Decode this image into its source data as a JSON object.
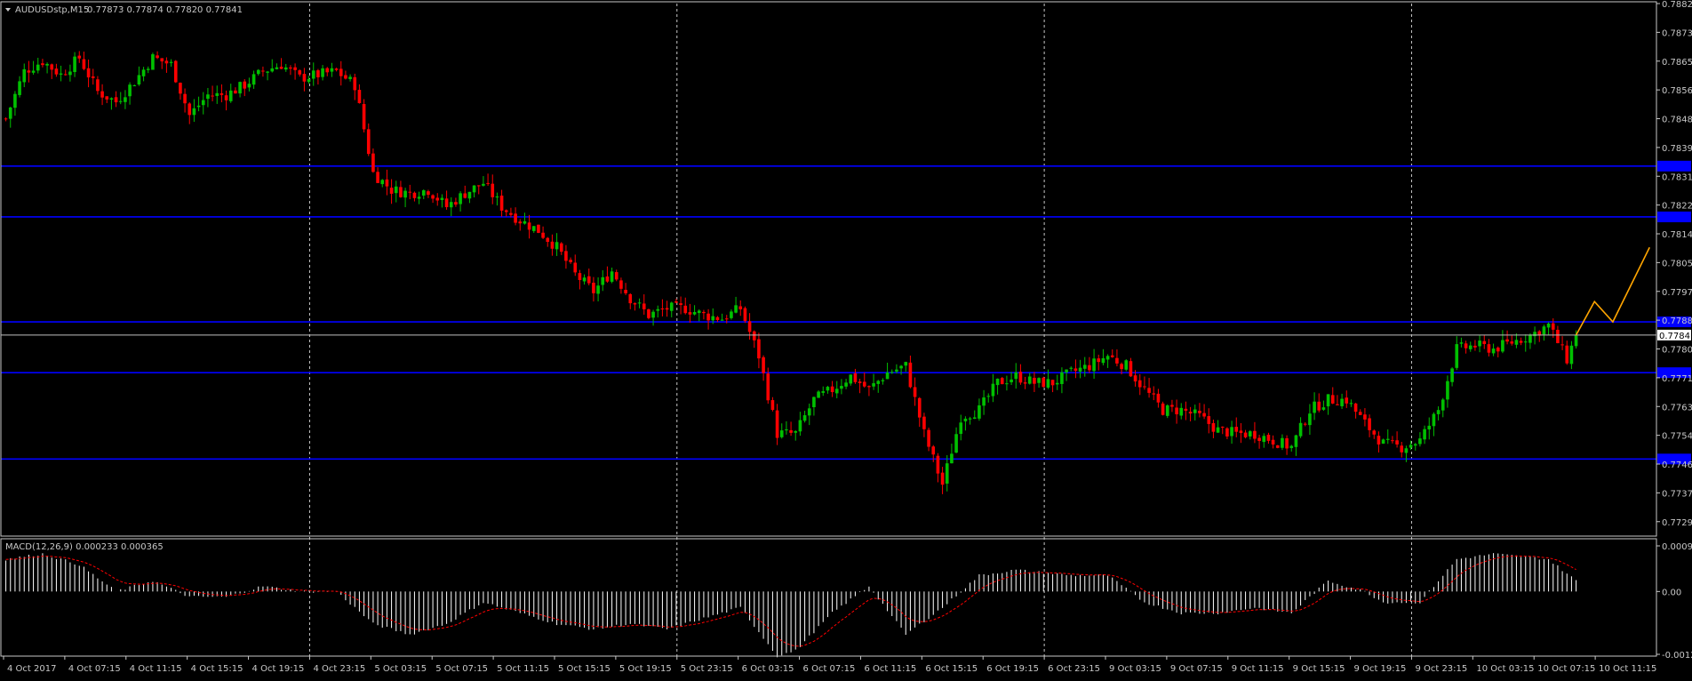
{
  "chart_data": {
    "type": "candlestick",
    "symbol_header": "AUDUSDstp,M15",
    "ohlc_header": "0.77873 0.77874 0.77820 0.77841",
    "last_price": 0.77841,
    "last_price_label": "0.77841",
    "ylim": [
      0.7725,
      0.7882
    ],
    "price_ticks": [
      "0.78820",
      "0.78735",
      "0.78650",
      "0.78565",
      "0.78480",
      "0.78395",
      "0.78310",
      "0.78225",
      "0.78140",
      "0.78055",
      "0.77970",
      "0.77885",
      "0.77800",
      "0.77715",
      "0.77630",
      "0.77545",
      "0.77460",
      "0.77375",
      "0.77290"
    ],
    "horizontal_levels": [
      0.7834,
      0.7819,
      0.7788,
      0.7773,
      0.77475
    ],
    "horizontal_level_color": "#0000ff",
    "time_labels": [
      "4 Oct 2017",
      "4 Oct 07:15",
      "4 Oct 11:15",
      "4 Oct 15:15",
      "4 Oct 19:15",
      "4 Oct 23:15",
      "5 Oct 03:15",
      "5 Oct 07:15",
      "5 Oct 11:15",
      "5 Oct 15:15",
      "5 Oct 19:15",
      "5 Oct 23:15",
      "6 Oct 03:15",
      "6 Oct 07:15",
      "6 Oct 11:15",
      "6 Oct 15:15",
      "6 Oct 19:15",
      "6 Oct 23:15",
      "9 Oct 03:15",
      "9 Oct 07:15",
      "9 Oct 11:15",
      "9 Oct 15:15",
      "9 Oct 19:15",
      "9 Oct 23:15",
      "10 Oct 03:15",
      "10 Oct 07:15",
      "10 Oct 11:15"
    ],
    "day_separator_labels": [
      "4 Oct 23:15",
      "5 Oct 23:15",
      "6 Oct 23:15",
      "9 Oct 23:15"
    ],
    "close_path": [
      [
        0,
        0.7848
      ],
      [
        4,
        0.7862
      ],
      [
        8,
        0.7865
      ],
      [
        12,
        0.7861
      ],
      [
        16,
        0.7866
      ],
      [
        20,
        0.7856
      ],
      [
        24,
        0.7853
      ],
      [
        28,
        0.7859
      ],
      [
        32,
        0.7866
      ],
      [
        36,
        0.7864
      ],
      [
        40,
        0.7849
      ],
      [
        44,
        0.7855
      ],
      [
        48,
        0.7855
      ],
      [
        52,
        0.7858
      ],
      [
        56,
        0.7862
      ],
      [
        60,
        0.7864
      ],
      [
        64,
        0.786
      ],
      [
        68,
        0.7861
      ],
      [
        72,
        0.7862
      ],
      [
        76,
        0.7858
      ],
      [
        80,
        0.7832
      ],
      [
        84,
        0.7827
      ],
      [
        88,
        0.7826
      ],
      [
        92,
        0.7827
      ],
      [
        96,
        0.7822
      ],
      [
        100,
        0.7826
      ],
      [
        104,
        0.7829
      ],
      [
        108,
        0.7822
      ],
      [
        112,
        0.7818
      ],
      [
        116,
        0.7815
      ],
      [
        120,
        0.781
      ],
      [
        124,
        0.7802
      ],
      [
        128,
        0.7797
      ],
      [
        132,
        0.7803
      ],
      [
        136,
        0.7795
      ],
      [
        140,
        0.779
      ],
      [
        144,
        0.7792
      ],
      [
        148,
        0.7792
      ],
      [
        152,
        0.779
      ],
      [
        156,
        0.7789
      ],
      [
        160,
        0.7792
      ],
      [
        164,
        0.7778
      ],
      [
        168,
        0.7755
      ],
      [
        172,
        0.7755
      ],
      [
        176,
        0.7765
      ],
      [
        180,
        0.7768
      ],
      [
        184,
        0.7772
      ],
      [
        188,
        0.7768
      ],
      [
        192,
        0.7773
      ],
      [
        196,
        0.7775
      ],
      [
        200,
        0.7755
      ],
      [
        204,
        0.774
      ],
      [
        208,
        0.776
      ],
      [
        212,
        0.7762
      ],
      [
        216,
        0.777
      ],
      [
        220,
        0.7772
      ],
      [
        224,
        0.777
      ],
      [
        228,
        0.777
      ],
      [
        232,
        0.7773
      ],
      [
        236,
        0.7775
      ],
      [
        240,
        0.7778
      ],
      [
        244,
        0.7775
      ],
      [
        248,
        0.7768
      ],
      [
        252,
        0.7762
      ],
      [
        256,
        0.7762
      ],
      [
        260,
        0.776
      ],
      [
        264,
        0.7756
      ],
      [
        268,
        0.7755
      ],
      [
        272,
        0.7755
      ],
      [
        276,
        0.7753
      ],
      [
        280,
        0.7751
      ],
      [
        284,
        0.7762
      ],
      [
        288,
        0.7765
      ],
      [
        292,
        0.7765
      ],
      [
        296,
        0.7758
      ],
      [
        300,
        0.7752
      ],
      [
        304,
        0.7751
      ],
      [
        308,
        0.7753
      ],
      [
        312,
        0.7762
      ],
      [
        316,
        0.778
      ],
      [
        320,
        0.7781
      ],
      [
        324,
        0.778
      ],
      [
        328,
        0.7782
      ],
      [
        332,
        0.7784
      ],
      [
        336,
        0.7787
      ],
      [
        340,
        0.7777
      ],
      [
        342,
        0.7784
      ]
    ],
    "forecast_path": [
      [
        342,
        0.77841
      ],
      [
        346,
        0.7794
      ],
      [
        350,
        0.7788
      ],
      [
        358,
        0.781
      ]
    ],
    "forecast_color": "#ffa500",
    "up_color": "#00c000",
    "down_color": "#ff0000",
    "macd": {
      "label": "MACD(12,26,9) 0.000233 0.000365",
      "ylim": [
        -0.0012,
        0.00098
      ],
      "ticks": [
        "0.000975",
        "0.00",
        "-0.00124"
      ],
      "anchors": [
        [
          0,
          0.0006
        ],
        [
          8,
          0.0007
        ],
        [
          16,
          0.0005
        ],
        [
          24,
          0.0
        ],
        [
          32,
          0.0002
        ],
        [
          40,
          -0.0001
        ],
        [
          48,
          -0.0001
        ],
        [
          56,
          0.0001
        ],
        [
          64,
          0.0
        ],
        [
          72,
          0.0
        ],
        [
          80,
          -0.0006
        ],
        [
          88,
          -0.0008
        ],
        [
          96,
          -0.0006
        ],
        [
          104,
          -0.0002
        ],
        [
          112,
          -0.0004
        ],
        [
          120,
          -0.0006
        ],
        [
          128,
          -0.0007
        ],
        [
          136,
          -0.0006
        ],
        [
          144,
          -0.0007
        ],
        [
          152,
          -0.0005
        ],
        [
          160,
          -0.0003
        ],
        [
          168,
          -0.0012
        ],
        [
          172,
          -0.0011
        ],
        [
          180,
          -0.0004
        ],
        [
          188,
          0.0001
        ],
        [
          196,
          -0.0008
        ],
        [
          204,
          -0.0003
        ],
        [
          212,
          0.0003
        ],
        [
          220,
          0.0004
        ],
        [
          232,
          0.0003
        ],
        [
          240,
          0.0003
        ],
        [
          248,
          -0.0002
        ],
        [
          256,
          -0.0004
        ],
        [
          264,
          -0.0004
        ],
        [
          272,
          -0.0003
        ],
        [
          280,
          -0.0004
        ],
        [
          288,
          0.0002
        ],
        [
          296,
          0.0
        ],
        [
          300,
          -0.0002
        ],
        [
          308,
          -0.0002
        ],
        [
          316,
          0.0006
        ],
        [
          324,
          0.0007
        ],
        [
          336,
          0.0006
        ],
        [
          342,
          0.0002
        ]
      ],
      "histogram_color": "#ffffff",
      "signal_color": "#ff0000"
    }
  }
}
